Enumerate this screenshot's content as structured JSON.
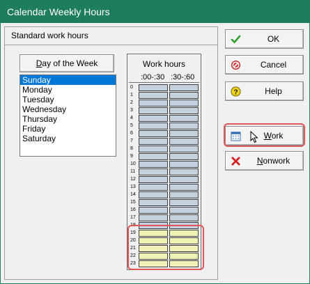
{
  "window": {
    "title": "Calendar Weekly Hours"
  },
  "group": {
    "title": "Standard work hours"
  },
  "day_of_week": {
    "header_underlined": "D",
    "header_rest": "ay of the Week",
    "days": [
      "Sunday",
      "Monday",
      "Tuesday",
      "Wednesday",
      "Thursday",
      "Friday",
      "Saturday"
    ],
    "selected_index": 0
  },
  "work_hours": {
    "title": "Work hours",
    "col1": ":00-:30",
    "col2": ":30-:60",
    "hours": [
      "0",
      "1",
      "2",
      "3",
      "4",
      "5",
      "6",
      "7",
      "8",
      "9",
      "10",
      "11",
      "12",
      "13",
      "14",
      "15",
      "16",
      "17",
      "18",
      "19",
      "20",
      "21",
      "22",
      "23"
    ],
    "work_hours": [
      19,
      20,
      21,
      22,
      23
    ],
    "colors": {
      "nonwork": "#c4d2e0",
      "work": "#f2f2b6"
    }
  },
  "buttons": {
    "ok": {
      "label": "OK",
      "icon": "checkmark-icon"
    },
    "cancel": {
      "label": "Cancel",
      "icon": "no-entry-icon"
    },
    "help": {
      "label": "Help",
      "icon": "question-icon"
    },
    "work": {
      "underlined": "W",
      "rest": "ork",
      "icon": "calendar-icon"
    },
    "nonwork": {
      "underlined": "N",
      "rest": "onwork",
      "icon": "red-x-icon"
    }
  },
  "accent_color": "#1e7d5c",
  "highlight_color": "#e05555"
}
